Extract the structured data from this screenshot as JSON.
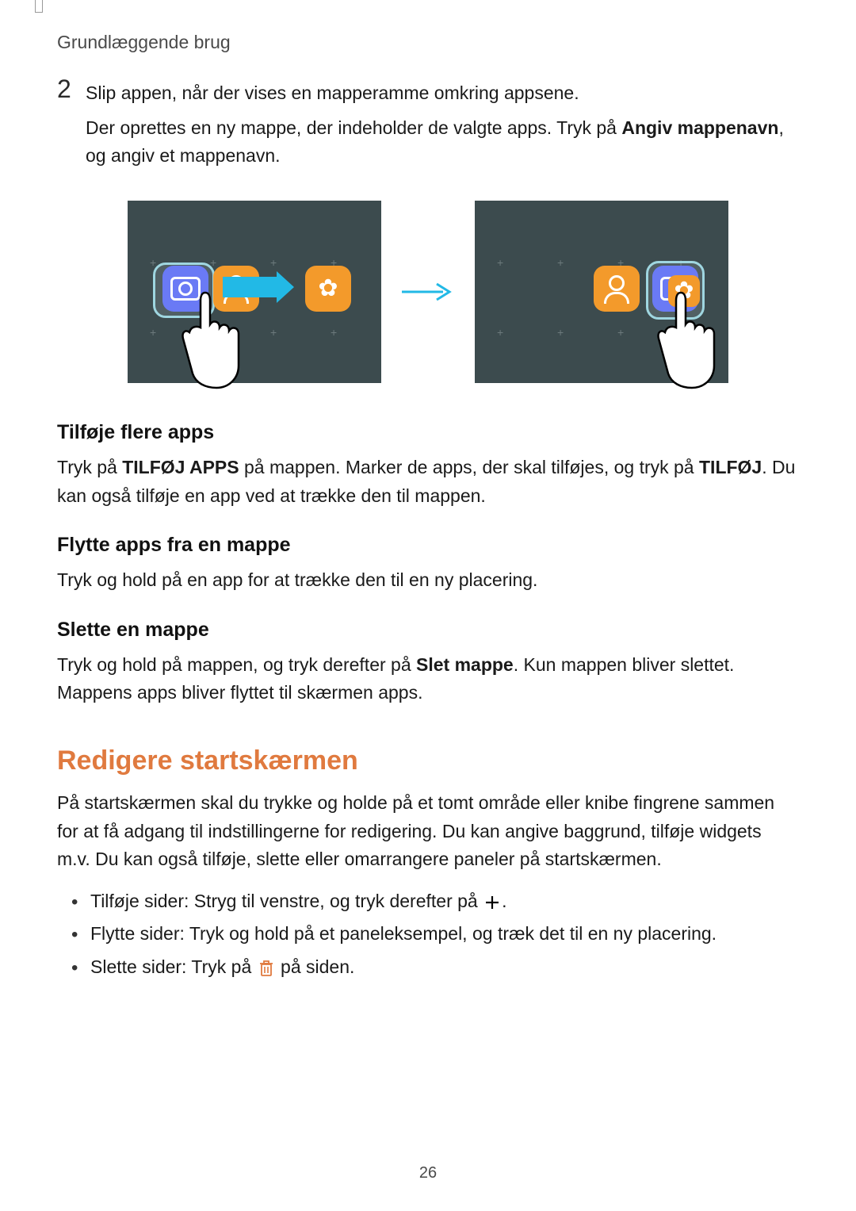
{
  "header": {
    "breadcrumb": "Grundlæggende brug"
  },
  "step": {
    "number": "2",
    "line1": "Slip appen, når der vises en mapperamme omkring appsene.",
    "line2_a": "Der oprettes en ny mappe, der indeholder de valgte apps. Tryk på ",
    "line2_bold": "Angiv mappenavn",
    "line2_b": ", og angiv et mappenavn."
  },
  "sub1": {
    "heading": "Tilføje flere apps",
    "p1_a": "Tryk på ",
    "p1_bold1": "TILFØJ APPS",
    "p1_b": " på mappen. Marker de apps, der skal tilføjes, og tryk på ",
    "p1_bold2": "TILFØJ",
    "p1_c": ". Du kan også tilføje en app ved at trække den til mappen."
  },
  "sub2": {
    "heading": "Flytte apps fra en mappe",
    "p": "Tryk og hold på en app for at trække den til en ny placering."
  },
  "sub3": {
    "heading": "Slette en mappe",
    "p_a": "Tryk og hold på mappen, og tryk derefter på ",
    "p_bold": "Slet mappe",
    "p_b": ". Kun mappen bliver slettet. Mappens apps bliver flyttet til skærmen apps."
  },
  "section": {
    "heading": "Redigere startskærmen",
    "intro": "På startskærmen skal du trykke og holde på et tomt område eller knibe fingrene sammen for at få adgang til indstillingerne for redigering. Du kan angive baggrund, tilføje widgets m.v. Du kan også tilføje, slette eller omarrangere paneler på startskærmen.",
    "bullets": {
      "b1_a": "Tilføje sider: Stryg til venstre, og tryk derefter på ",
      "b1_b": ".",
      "b2": "Flytte sider: Tryk og hold på et paneleksempel, og træk det til en ny placering.",
      "b3_a": "Slette sider: Tryk på ",
      "b3_b": " på siden."
    }
  },
  "page_number": "26"
}
